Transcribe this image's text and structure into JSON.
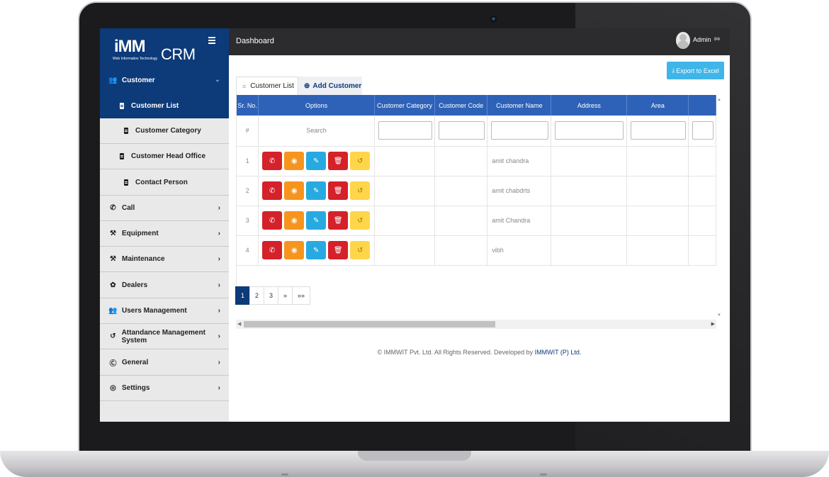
{
  "brand": {
    "logo_text": "iMM",
    "logo_tagline": "Web Information Technology",
    "product": "CRM"
  },
  "topbar": {
    "title": "Dashboard",
    "user": "Admin"
  },
  "sidebar": {
    "section": {
      "label": "Customer",
      "icon": "users-icon"
    },
    "sub_items": [
      {
        "label": "Customer List",
        "active": true
      },
      {
        "label": "Customer Category"
      },
      {
        "label": "Customer Head Office"
      },
      {
        "label": "Contact Person"
      }
    ],
    "items": [
      {
        "label": "Call",
        "icon": "phone-icon"
      },
      {
        "label": "Equipment",
        "icon": "tools-icon"
      },
      {
        "label": "Maintenance",
        "icon": "tools-icon"
      },
      {
        "label": "Dealers",
        "icon": "leaf-icon"
      },
      {
        "label": "Users Management",
        "icon": "users-icon"
      },
      {
        "label": "Attandance Management System",
        "icon": "history-icon"
      },
      {
        "label": "General",
        "icon": "cc-icon"
      },
      {
        "label": "Settings",
        "icon": "lifebuoy-icon"
      }
    ]
  },
  "actions": {
    "export_label": "Export to Excel"
  },
  "tabs": {
    "list_label": "Customer List",
    "add_label": "Add Customer"
  },
  "table": {
    "headers": [
      "Sr. No.",
      "Options",
      "Customer Category",
      "Customer Code",
      "Customer Name",
      "Address",
      "Area"
    ],
    "filter": {
      "sr": "#",
      "options": "Search"
    },
    "rows": [
      {
        "sr": "1",
        "category": "",
        "code": "",
        "name": "amit chandra",
        "address": "",
        "area": ""
      },
      {
        "sr": "2",
        "category": "",
        "code": "",
        "name": "amit chabdrts",
        "address": "",
        "area": ""
      },
      {
        "sr": "3",
        "category": "",
        "code": "",
        "name": "amit Chandra",
        "address": "",
        "area": ""
      },
      {
        "sr": "4",
        "category": "",
        "code": "",
        "name": "vibh",
        "address": "",
        "area": ""
      }
    ],
    "row_buttons": [
      {
        "icon": "phone-icon",
        "color": "#d4212a"
      },
      {
        "icon": "eye-icon",
        "color": "#f7941d"
      },
      {
        "icon": "pencil-icon",
        "color": "#27aae1"
      },
      {
        "icon": "trash-icon",
        "color": "#d4212a"
      },
      {
        "icon": "history-icon",
        "color": "#ffd54a"
      }
    ]
  },
  "pagination": {
    "pages": [
      "1",
      "2",
      "3"
    ],
    "next": "»",
    "last": "»»",
    "current": "1"
  },
  "footer": {
    "copyright": "© IMMWIT Pvt. Ltd. All Rights Reserved. Developed by ",
    "developer": "IMMWIT (P) Ltd."
  },
  "colors": {
    "brand": "#0d3a78",
    "header": "#2e62b8",
    "topbar": "#2c2c2e",
    "export": "#3fb5e8"
  }
}
